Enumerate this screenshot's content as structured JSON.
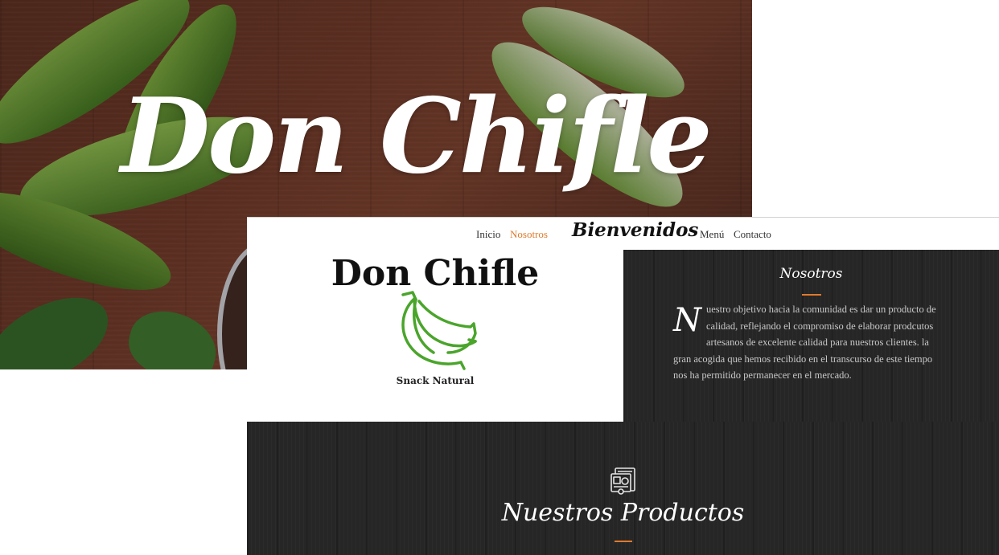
{
  "hero": {
    "title": "Don Chifle"
  },
  "nav": {
    "items": [
      {
        "label": "Inicio",
        "active": false
      },
      {
        "label": "Nosotros",
        "active": true
      },
      {
        "label": "Menú",
        "active": false
      },
      {
        "label": "Contacto",
        "active": false
      }
    ],
    "brand": "Bienvenidos",
    "active_color": "#e07a2c"
  },
  "logo": {
    "title": "Don Chifle",
    "icon": "banana-icon",
    "icon_color": "#4aa52b",
    "subtitle": "Snack Natural"
  },
  "about": {
    "title": "Nosotros",
    "dropcap": "N",
    "text": "uestro objetivo hacia la comunidad es dar un producto de calidad, reflejando el compromiso de elaborar prodcutos artesanos de excelente calidad para nuestros clientes. la gran acogida que hemos recibido en el transcurso de este tiempo nos ha permitido permanecer en el mercado."
  },
  "products": {
    "icon": "products-icon",
    "title": "Nuestros Productos"
  },
  "colors": {
    "accent": "#e07a2c",
    "dark_bg": "#262626"
  }
}
